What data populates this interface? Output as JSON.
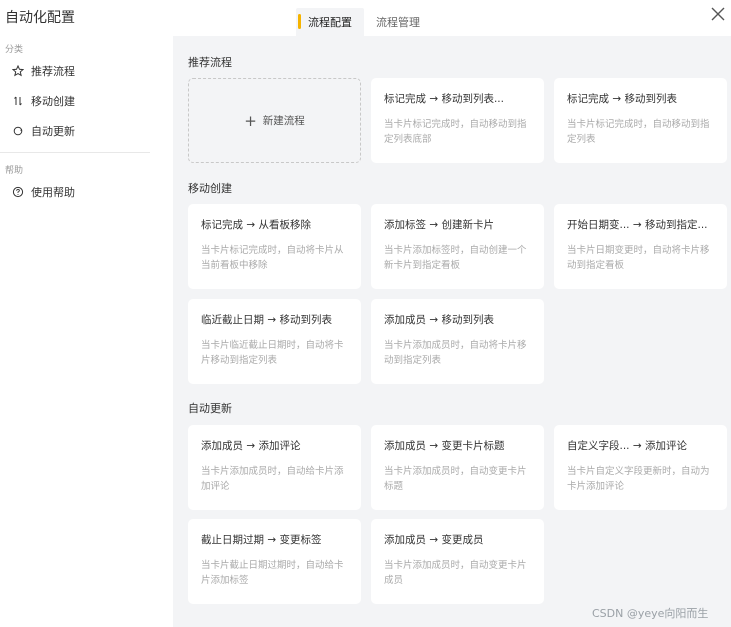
{
  "window": {
    "title": "自动化配置"
  },
  "tabs": [
    {
      "label": "流程配置",
      "active": true
    },
    {
      "label": "流程管理",
      "active": false
    }
  ],
  "sidebar": {
    "category_header": "分类",
    "items": [
      {
        "label": "推荐流程",
        "icon": "star-icon"
      },
      {
        "label": "移动创建",
        "icon": "arrows-updown-icon"
      },
      {
        "label": "自动更新",
        "icon": "refresh-icon"
      }
    ],
    "help_header": "帮助",
    "help_items": [
      {
        "label": "使用帮助",
        "icon": "help-circle-icon"
      }
    ]
  },
  "sections": {
    "recommended": {
      "title": "推荐流程",
      "new_label": "新建流程",
      "cards": [
        {
          "title": "标记完成 → 移动到列表...",
          "desc": "当卡片标记完成时，自动移动到指定列表底部"
        },
        {
          "title": "标记完成 → 移动到列表",
          "desc": "当卡片标记完成时，自动移动到指定列表"
        }
      ]
    },
    "move_create": {
      "title": "移动创建",
      "cards": [
        {
          "title": "标记完成 → 从看板移除",
          "desc": "当卡片标记完成时，自动将卡片从当前看板中移除"
        },
        {
          "title": "添加标签 → 创建新卡片",
          "desc": "当卡片添加标签时，自动创建一个新卡片到指定看板"
        },
        {
          "title": "开始日期变... → 移动到指定...",
          "desc": "当卡片日期变更时，自动将卡片移动到指定看板"
        },
        {
          "title": "临近截止日期 → 移动到列表",
          "desc": "当卡片临近截止日期时，自动将卡片移动到指定列表"
        },
        {
          "title": "添加成员 → 移动到列表",
          "desc": "当卡片添加成员时，自动将卡片移动到指定列表"
        }
      ]
    },
    "auto_update": {
      "title": "自动更新",
      "cards": [
        {
          "title": "添加成员 → 添加评论",
          "desc": "当卡片添加成员时，自动给卡片添加评论"
        },
        {
          "title": "添加成员 → 变更卡片标题",
          "desc": "当卡片添加成员时，自动变更卡片标题"
        },
        {
          "title": "自定义字段... → 添加评论",
          "desc": "当卡片自定义字段更新时，自动为卡片添加评论"
        },
        {
          "title": "截止日期过期 → 变更标签",
          "desc": "当卡片截止日期过期时，自动给卡片添加标签"
        },
        {
          "title": "添加成员 → 变更成员",
          "desc": "当卡片添加成员时，自动变更卡片成员"
        }
      ]
    }
  },
  "watermark": "CSDN @yeye向阳而生",
  "colors": {
    "accent": "#f5b300",
    "panel_bg": "#f3f4f6",
    "card_bg": "#ffffff",
    "muted_text": "#aaaaaa"
  }
}
